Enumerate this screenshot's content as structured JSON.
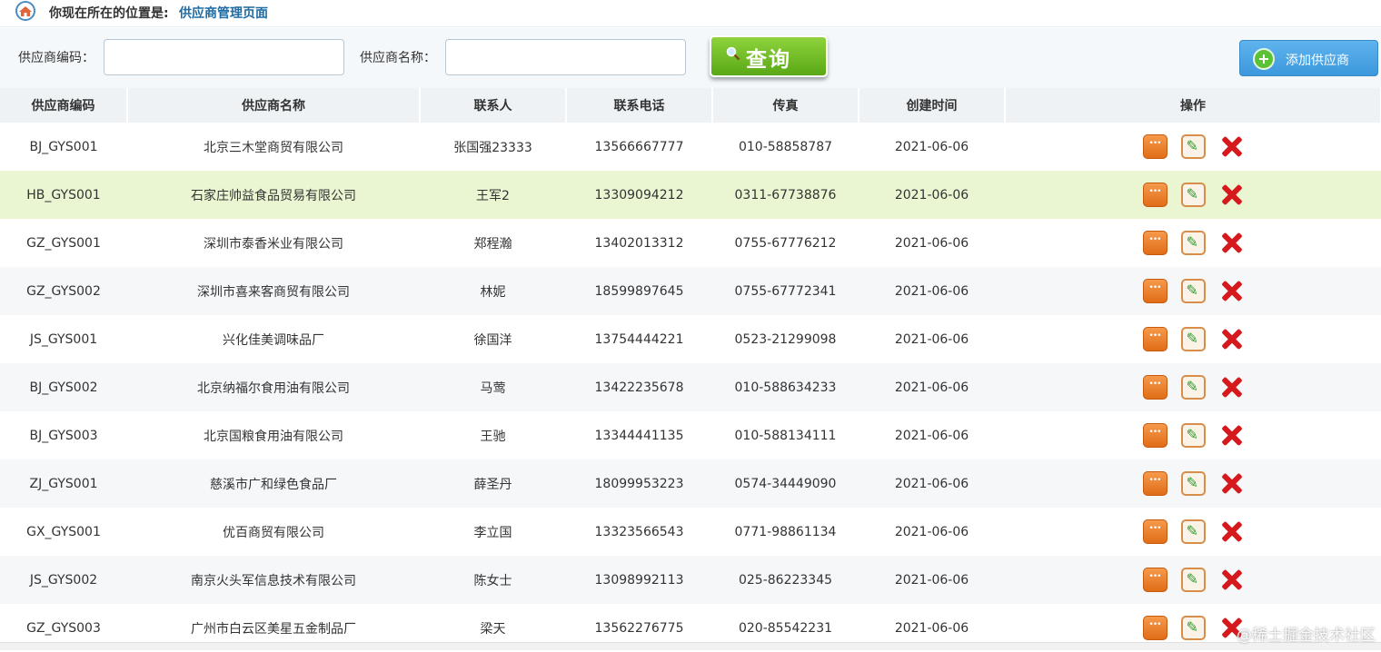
{
  "breadcrumb": {
    "prefix": "你现在所在的位置是:",
    "current": "供应商管理页面"
  },
  "search": {
    "code_label": "供应商编码：",
    "code_value": "",
    "code_placeholder": "",
    "name_label": "供应商名称：",
    "name_value": "",
    "name_placeholder": "",
    "query_label": "查询",
    "add_label": "添加供应商"
  },
  "table": {
    "columns": [
      "供应商编码",
      "供应商名称",
      "联系人",
      "联系电话",
      "传真",
      "创建时间",
      "操作"
    ],
    "rows": [
      [
        "BJ_GYS001",
        "北京三木堂商贸有限公司",
        "张国强23333",
        "13566667777",
        "010-58858787",
        "2021-06-06"
      ],
      [
        "HB_GYS001",
        "石家庄帅益食品贸易有限公司",
        "王军2",
        "13309094212",
        "0311-67738876",
        "2021-06-06"
      ],
      [
        "GZ_GYS001",
        "深圳市泰香米业有限公司",
        "郑程瀚",
        "13402013312",
        "0755-67776212",
        "2021-06-06"
      ],
      [
        "GZ_GYS002",
        "深圳市喜来客商贸有限公司",
        "林妮",
        "18599897645",
        "0755-67772341",
        "2021-06-06"
      ],
      [
        "JS_GYS001",
        "兴化佳美调味品厂",
        "徐国洋",
        "13754444221",
        "0523-21299098",
        "2021-06-06"
      ],
      [
        "BJ_GYS002",
        "北京纳福尔食用油有限公司",
        "马莺",
        "13422235678",
        "010-588634233",
        "2021-06-06"
      ],
      [
        "BJ_GYS003",
        "北京国粮食用油有限公司",
        "王驰",
        "13344441135",
        "010-588134111",
        "2021-06-06"
      ],
      [
        "ZJ_GYS001",
        "慈溪市广和绿色食品厂",
        "薛圣丹",
        "18099953223",
        "0574-34449090",
        "2021-06-06"
      ],
      [
        "GX_GYS001",
        "优百商贸有限公司",
        "李立国",
        "13323566543",
        "0771-98861134",
        "2021-06-06"
      ],
      [
        "JS_GYS002",
        "南京火头军信息技术有限公司",
        "陈女士",
        "13098992113",
        "025-86223345",
        "2021-06-06"
      ],
      [
        "GZ_GYS003",
        "广州市白云区美星五金制品厂",
        "梁天",
        "13562276775",
        "020-85542231",
        "2021-06-06"
      ]
    ],
    "highlighted_row": 1
  },
  "watermark": "@稀土掘金技术社区",
  "colors": {
    "accent": "#1e6ba4",
    "query_green": "#6cbd22",
    "add_blue": "#4aa6e6",
    "highlight": "#eaf6d2"
  }
}
